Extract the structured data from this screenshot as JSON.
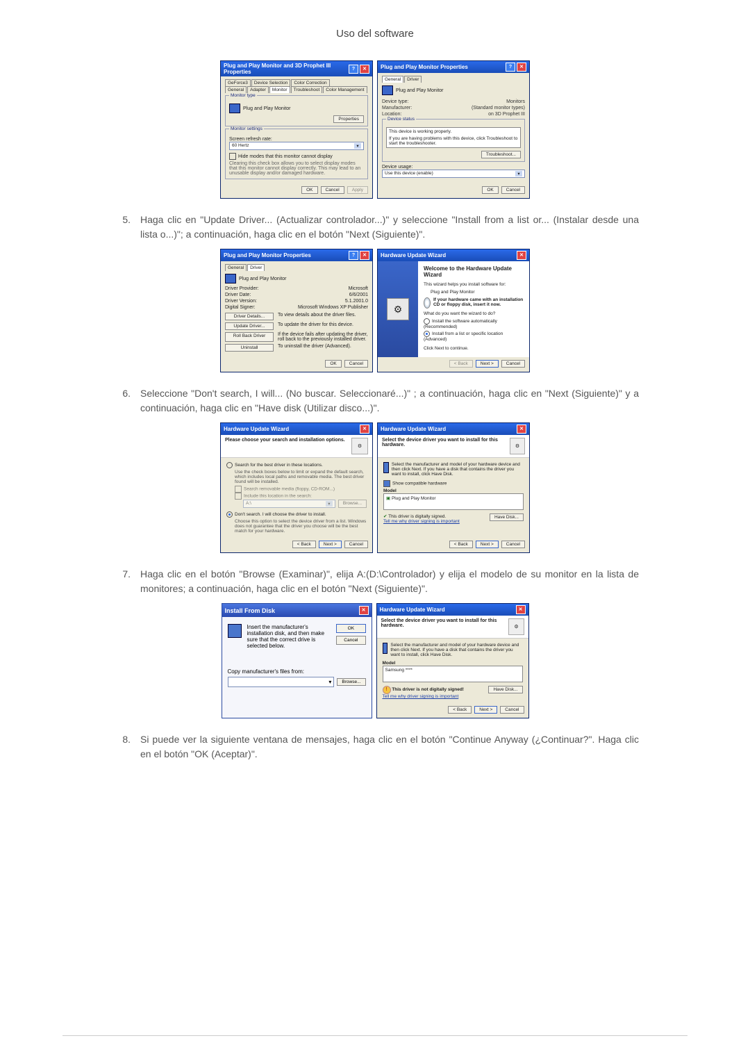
{
  "page_header": "Uso del software",
  "step5": {
    "num": "5.",
    "text": "Haga clic en \"Update Driver... (Actualizar controlador...)\" y seleccione \"Install from a list or... (Instalar desde una lista o...)\"; a continuación, haga clic en el botón \"Next (Siguiente)\"."
  },
  "step6": {
    "num": "6.",
    "text": "Seleccione \"Don't search, I will... (No buscar. Seleccionaré...)\" ; a continuación, haga clic en \"Next (Siguiente)\" y a continuación, haga clic en \"Have disk (Utilizar disco...)\"."
  },
  "step7": {
    "num": "7.",
    "text": "Haga clic en el botón \"Browse (Examinar)\", elija A:(D:\\Controlador) y elija el modelo de su monitor en la lista de monitores; a continuación, haga clic en el botón \"Next (Siguiente)\"."
  },
  "step8": {
    "num": "8.",
    "text": "Si puede ver la siguiente ventana de mensajes, haga clic en el botón \"Continue Anyway (¿Continuar?\". Haga clic en el botón \"OK (Aceptar)\"."
  },
  "common": {
    "ok": "OK",
    "cancel": "Cancel",
    "apply": "Apply",
    "back": "< Back",
    "next": "Next >",
    "browse": "Browse...",
    "have_disk": "Have Disk..."
  },
  "dlg1a": {
    "title": "Plug and Play Monitor and 3D Prophet III Properties",
    "tabs_r1": [
      "GeForce3",
      "Device Selection",
      "Color Correction"
    ],
    "tabs_r2": [
      "General",
      "Adapter",
      "Monitor",
      "Troubleshoot",
      "Color Management"
    ],
    "grp_monitor_type": "Monitor type",
    "monitor_name": "Plug and Play Monitor",
    "properties_btn": "Properties",
    "grp_settings": "Monitor settings",
    "refresh_label": "Screen refresh rate:",
    "refresh_value": "60 Hertz",
    "hide_modes": "Hide modes that this monitor cannot display",
    "hide_desc": "Clearing this check box allows you to select display modes that this monitor cannot display correctly. This may lead to an unusable display and/or damaged hardware."
  },
  "dlg1b": {
    "title": "Plug and Play Monitor Properties",
    "tabs": [
      "General",
      "Driver"
    ],
    "name": "Plug and Play Monitor",
    "dev_type_l": "Device type:",
    "dev_type_v": "Monitors",
    "manu_l": "Manufacturer:",
    "manu_v": "(Standard monitor types)",
    "loc_l": "Location:",
    "loc_v": "on 3D Prophet III",
    "grp_status": "Device status",
    "status_ok": "This device is working properly.",
    "status_help": "If you are having problems with this device, click Troubleshoot to start the troubleshooter.",
    "troubleshoot": "Troubleshoot...",
    "usage_l": "Device usage:",
    "usage_v": "Use this device (enable)"
  },
  "dlg2a": {
    "title": "Plug and Play Monitor Properties",
    "tabs": [
      "General",
      "Driver"
    ],
    "name": "Plug and Play Monitor",
    "provider_l": "Driver Provider:",
    "provider_v": "Microsoft",
    "date_l": "Driver Date:",
    "date_v": "6/6/2001",
    "ver_l": "Driver Version:",
    "ver_v": "5.1.2001.0",
    "signer_l": "Digital Signer:",
    "signer_v": "Microsoft Windows XP Publisher",
    "btn_details": "Driver Details...",
    "btn_details_d": "To view details about the driver files.",
    "btn_update": "Update Driver...",
    "btn_update_d": "To update the driver for this device.",
    "btn_rollback": "Roll Back Driver",
    "btn_rollback_d": "If the device fails after updating the driver, roll back to the previously installed driver.",
    "btn_uninstall": "Uninstall",
    "btn_uninstall_d": "To uninstall the driver (Advanced)."
  },
  "dlg2b": {
    "title": "Hardware Update Wizard",
    "welcome": "Welcome to the Hardware Update Wizard",
    "intro": "This wizard helps you install software for:",
    "device": "Plug and Play Monitor",
    "cd_hint": "If your hardware came with an installation CD or floppy disk, insert it now.",
    "question": "What do you want the wizard to do?",
    "opt_auto": "Install the software automatically (Recommended)",
    "opt_list": "Install from a list or specific location (Advanced)",
    "cont": "Click Next to continue."
  },
  "dlg3a": {
    "title": "Hardware Update Wizard",
    "header": "Please choose your search and installation options.",
    "opt_search": "Search for the best driver in these locations.",
    "search_desc": "Use the check boxes below to limit or expand the default search, which includes local paths and removable media. The best driver found will be installed.",
    "chk_media": "Search removable media (floppy, CD-ROM...)",
    "chk_include": "Include this location in the search:",
    "path": "A:\\",
    "opt_dont": "Don't search. I will choose the driver to install.",
    "dont_desc": "Choose this option to select the device driver from a list. Windows does not guarantee that the driver you choose will be the best match for your hardware."
  },
  "dlg3b": {
    "title": "Hardware Update Wizard",
    "header": "Select the device driver you want to install for this hardware.",
    "instr": "Select the manufacturer and model of your hardware device and then click Next. If you have a disk that contains the driver you want to install, click Have Disk.",
    "chk_compat": "Show compatible hardware",
    "col_model": "Model",
    "item": "Plug and Play Monitor",
    "signed": "This driver is digitally signed.",
    "tell_me": "Tell me why driver signing is important"
  },
  "dlg4a": {
    "title": "Install From Disk",
    "instr": "Insert the manufacturer's installation disk, and then make sure that the correct drive is selected below.",
    "copy_from": "Copy manufacturer's files from:",
    "path": ""
  },
  "dlg4b": {
    "title": "Hardware Update Wizard",
    "header": "Select the device driver you want to install for this hardware.",
    "instr": "Select the manufacturer and model of your hardware device and then click Next. If you have a disk that contains the driver you want to install, click Have Disk.",
    "col_model": "Model",
    "item": "Samsung ****",
    "not_signed": "This driver is not digitally signed!",
    "tell_me": "Tell me why driver signing is important"
  }
}
